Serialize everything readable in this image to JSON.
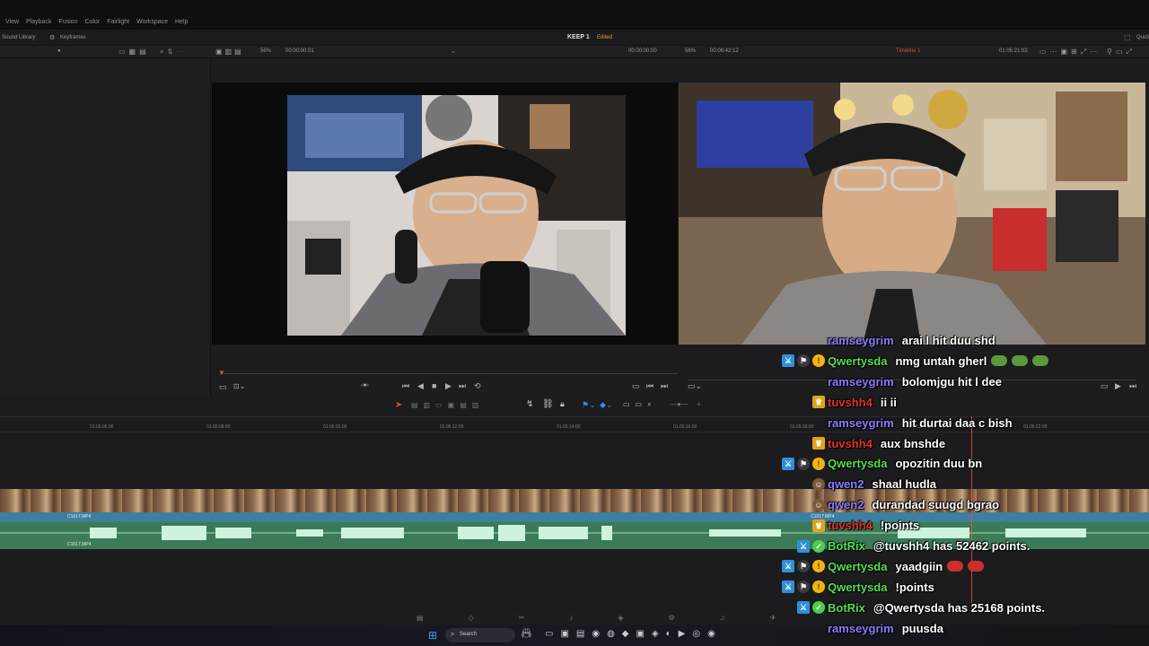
{
  "menu": [
    "View",
    "Playback",
    "Fusion",
    "Color",
    "Fairlight",
    "Workspace",
    "Help"
  ],
  "toolbar": {
    "sound_library": "Sound Library",
    "keyframes": "Keyframes",
    "project_title": "KEEP 1",
    "edited": "Edited",
    "timeline_name": "Timeline 1",
    "source_zoom": "56%",
    "source_timecode": "00:00:00:01",
    "program_timecode_left": "00:00:00:00",
    "program_zoom": "56%",
    "program_duration": "00:06:42:12",
    "program_timecode_right": "01:05:21:03"
  },
  "ruler": {
    "ticks": [
      "01:05:06:00",
      "01:05:08:00",
      "01:05:10:00",
      "01:05:12:00",
      "01:05:14:00",
      "01:05:16:00",
      "01:05:18:00",
      "01:05:20:00",
      "01:05:22:00"
    ]
  },
  "tracks": {
    "clip_name_video": "C1017.MP4",
    "clip_name_audio": "C1017.MP4"
  },
  "taskbar": {
    "search_label": "Search"
  },
  "chat": [
    {
      "user": "ramseygrim",
      "color": "#8a7cff",
      "badges": [],
      "message": "arai l hit duu shd",
      "emotes": 0
    },
    {
      "user": "Qwertysda",
      "color": "#52e052",
      "badges": [
        "mod",
        "vip",
        "sub"
      ],
      "message": "nmg untah gherl",
      "emotes": 3
    },
    {
      "user": "ramseygrim",
      "color": "#8a7cff",
      "badges": [],
      "message": "bolomjgu hit l dee",
      "emotes": 0
    },
    {
      "user": "tuvshh4",
      "color": "#e0352b",
      "badges": [
        "crown"
      ],
      "message": "ii ii",
      "emotes": 0
    },
    {
      "user": "ramseygrim",
      "color": "#8a7cff",
      "badges": [],
      "message": "hit durtai daa c bish",
      "emotes": 0
    },
    {
      "user": "tuvshh4",
      "color": "#e0352b",
      "badges": [
        "crown"
      ],
      "message": "aux bnshde",
      "emotes": 0
    },
    {
      "user": "Qwertysda",
      "color": "#52e052",
      "badges": [
        "mod",
        "vip",
        "sub"
      ],
      "message": "opozitin duu bn",
      "emotes": 0
    },
    {
      "user": "qwen2",
      "color": "#8a7cff",
      "badges": [
        "avatar"
      ],
      "message": "shaal hudla",
      "emotes": 0
    },
    {
      "user": "qwen2",
      "color": "#8a7cff",
      "badges": [
        "avatar"
      ],
      "message": "durandad suugd bgrao",
      "emotes": 0
    },
    {
      "user": "tuvshh4",
      "color": "#e0352b",
      "badges": [
        "crown"
      ],
      "message": "!points",
      "emotes": 0
    },
    {
      "user": "BotRix",
      "color": "#52e052",
      "badges": [
        "mod",
        "verified"
      ],
      "message": "@tuvshh4 has 52462 points.",
      "emotes": 0
    },
    {
      "user": "Qwertysda",
      "color": "#52e052",
      "badges": [
        "mod",
        "vip",
        "sub"
      ],
      "message": "yaadgiin",
      "emotes": 2
    },
    {
      "user": "Qwertysda",
      "color": "#52e052",
      "badges": [
        "mod",
        "vip",
        "sub"
      ],
      "message": "!points",
      "emotes": 0
    },
    {
      "user": "BotRix",
      "color": "#52e052",
      "badges": [
        "mod",
        "verified"
      ],
      "message": "@Qwertysda has 25168 points.",
      "emotes": 0
    },
    {
      "user": "ramseygrim",
      "color": "#8a7cff",
      "badges": [],
      "message": "puusda",
      "emotes": 0
    }
  ]
}
